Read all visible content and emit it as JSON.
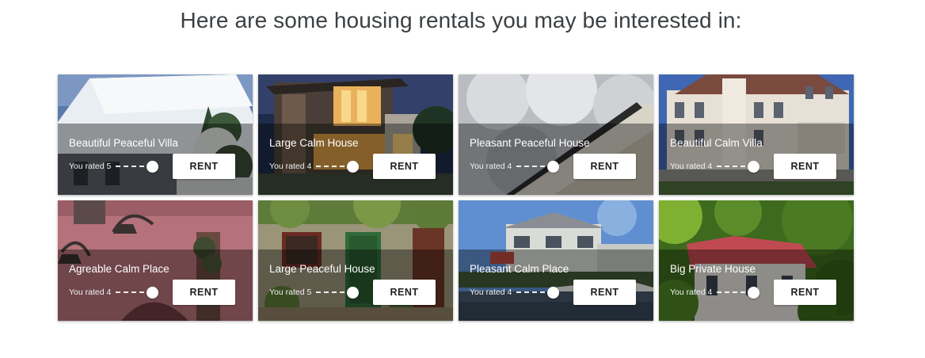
{
  "heading": "Here are some housing rentals you may be interested in:",
  "rent_label": "RENT",
  "cards": [
    {
      "title": "Beautiful Peaceful Villa",
      "rated": "You rated 5",
      "rating": 5
    },
    {
      "title": "Large Calm House",
      "rated": "You rated 4",
      "rating": 4
    },
    {
      "title": "Pleasant Peaceful House",
      "rated": "You rated 4",
      "rating": 4
    },
    {
      "title": "Beautiful Calm Villa",
      "rated": "You rated 4",
      "rating": 4
    },
    {
      "title": "Agreable Calm Place",
      "rated": "You rated 4",
      "rating": 4
    },
    {
      "title": "Large Peaceful House",
      "rated": "You rated 5",
      "rating": 5
    },
    {
      "title": "Pleasant Calm Place",
      "rated": "You rated 4",
      "rating": 4
    },
    {
      "title": "Big Private House",
      "rated": "You rated 4",
      "rating": 4
    }
  ]
}
